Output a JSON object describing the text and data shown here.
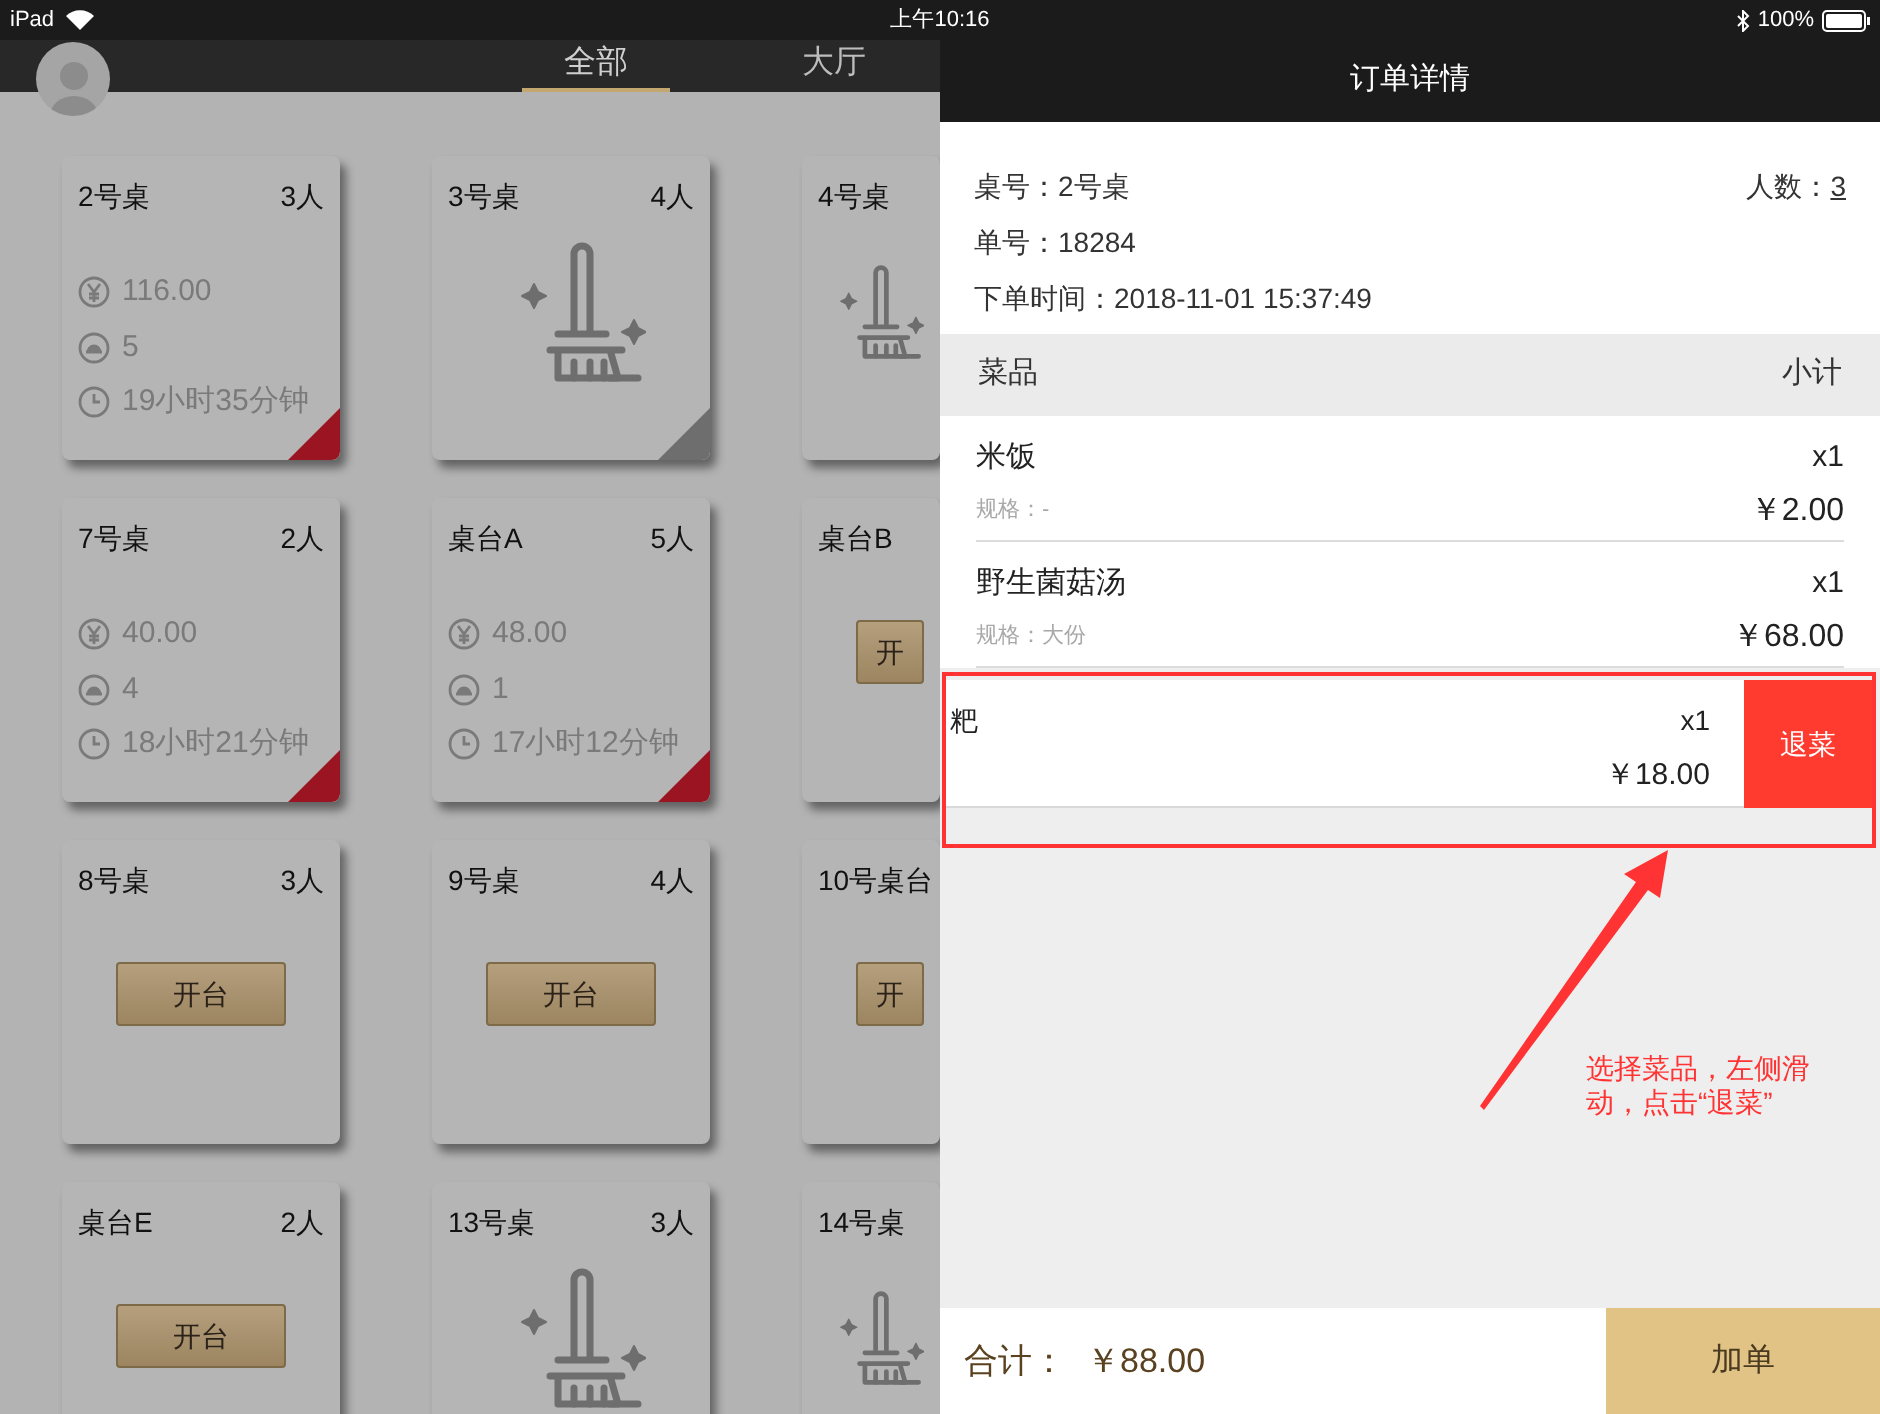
{
  "status_bar": {
    "device": "iPad",
    "time": "上午10:16",
    "battery": "100%"
  },
  "tabs": [
    {
      "label": "全部",
      "selected": true
    },
    {
      "label": "大厅",
      "selected": false
    }
  ],
  "tables": [
    {
      "kind": "occupied",
      "name": "2号桌",
      "seats": "3人",
      "amount": "116.00",
      "dishes": "5",
      "duration": "19小时35分钟",
      "color": "#9b1421"
    },
    {
      "kind": "cleaning",
      "name": "3号桌",
      "seats": "4人",
      "color": "#6e6e6e"
    },
    {
      "kind": "cleaning",
      "name": "4号桌"
    },
    {
      "kind": "occupied",
      "name": "7号桌",
      "seats": "2人",
      "amount": "40.00",
      "dishes": "4",
      "duration": "18小时21分钟",
      "color": "#9b1421"
    },
    {
      "kind": "occupied",
      "name": "桌台A",
      "seats": "5人",
      "amount": "48.00",
      "dishes": "1",
      "duration": "17小时12分钟",
      "color": "#9b1421"
    },
    {
      "kind": "vacant",
      "name": "桌台B",
      "button": "开"
    },
    {
      "kind": "vacant",
      "name": "8号桌",
      "seats": "3人",
      "button": "开台"
    },
    {
      "kind": "vacant",
      "name": "9号桌",
      "seats": "4人",
      "button": "开台"
    },
    {
      "kind": "vacant",
      "name": "10号桌台",
      "button": "开"
    },
    {
      "kind": "vacant",
      "name": "桌台E",
      "seats": "2人",
      "button": "开台"
    },
    {
      "kind": "cleaning",
      "name": "13号桌",
      "seats": "3人"
    },
    {
      "kind": "cleaning",
      "name": "14号桌"
    }
  ],
  "order": {
    "title": "订单详情",
    "fields": [
      {
        "label": "桌号：",
        "value": "2号桌"
      },
      {
        "label": "单号：",
        "value": "18284"
      },
      {
        "label": "下单时间：",
        "value": "2018-11-01 15:37:49"
      }
    ],
    "guests": {
      "label": "人数：",
      "value": "3"
    },
    "columns": [
      "菜品",
      "小计"
    ],
    "items": [
      {
        "name": "米饭",
        "qty": "x1",
        "spec_label": "规格：",
        "spec": "-",
        "price": "￥2.00",
        "swiped": false
      },
      {
        "name": "野生菌菇汤",
        "qty": "x1",
        "spec_label": "规格：",
        "spec": "大份",
        "price": "￥68.00",
        "swiped": false
      },
      {
        "name": "粑",
        "qty": "x1",
        "price": "￥18.00",
        "swiped": true,
        "action": "退菜"
      }
    ],
    "total": {
      "label": "合计：",
      "value": "￥88.00"
    },
    "add_button": "加单"
  },
  "annotation": "选择菜品，左侧滑动，点击“退菜”"
}
